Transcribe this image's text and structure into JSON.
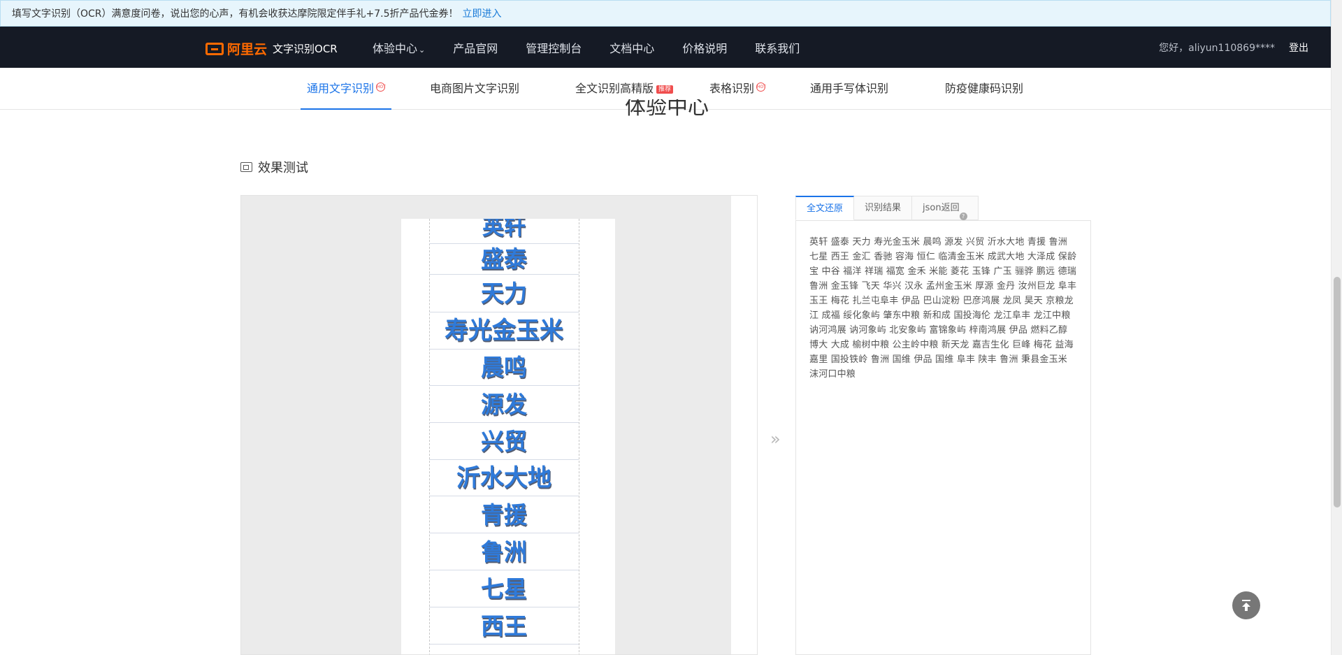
{
  "banner": {
    "text": "填写文字识别（OCR）满意度问卷，说出您的心声，有机会收获达摩院限定伴手礼+7.5折产品代金券！",
    "link": "立即进入"
  },
  "navbar": {
    "brand": "阿里云",
    "product": "文字识别OCR",
    "items": [
      {
        "label": "体验中心",
        "chevron": "⌄"
      },
      {
        "label": "产品官网"
      },
      {
        "label": "管理控制台"
      },
      {
        "label": "文档中心"
      },
      {
        "label": "价格说明"
      },
      {
        "label": "联系我们"
      }
    ],
    "greeting": "您好，aliyun110869****",
    "logout": "登出"
  },
  "subtabs": [
    {
      "label": "通用文字识别",
      "badge": "HOT",
      "active": true
    },
    {
      "label": "电商图片文字识别"
    },
    {
      "label": "全文识别高精版",
      "badge": "推荐"
    },
    {
      "label": "表格识别",
      "badge": "HOT"
    },
    {
      "label": "通用手写体识别"
    },
    {
      "label": "防疫健康码识别"
    }
  ],
  "center_title": "体验中心",
  "section_title": "效果测试",
  "preview_rows": [
    "英轩",
    "盛泰",
    "天力",
    "寿光金玉米",
    "晨鸣",
    "源发",
    "兴贸",
    "沂水大地",
    "青援",
    "鲁洲",
    "七星",
    "西王"
  ],
  "result_tabs": [
    "全文还原",
    "识别结果",
    "json返回"
  ],
  "result_text": "英轩 盛泰 天力 寿光金玉米 晨鸣 源发 兴贸 沂水大地 青援 鲁洲 七星 西王 金汇 香驰 容海 恒仁 临清金玉米 成武大地 大泽成 保龄宝 中谷 福洋 祥瑞 福宽 金禾 米能 菱花 玉锋 广玉 骊骅 鹏远 德瑞 鲁洲 金玉锋 飞天 华兴 汉永 孟州金玉米 厚源 金丹 汝州巨龙 阜丰 玉王 梅花 扎兰屯阜丰 伊品 巴山淀粉 巴彦鸿展 龙凤 昊天 京粮龙江 成福 绥化象屿 肇东中粮 新和成 国投海伦 龙江阜丰 龙江中粮 讷河鸿展 讷河象屿 北安象屿 富锦象屿 梓南鸿展 伊品 燃料乙醇 博大 大成 榆树中粮 公主岭中粮 新天龙 嘉吉生化 巨峰 梅花 益海嘉里 国投铁岭 鲁洲 国维 伊品 国维 阜丰 陕丰 鲁洲 秉县金玉米 沫河口中粮",
  "icons": {
    "arrow": "»",
    "question": "?",
    "hot": "HOT"
  }
}
